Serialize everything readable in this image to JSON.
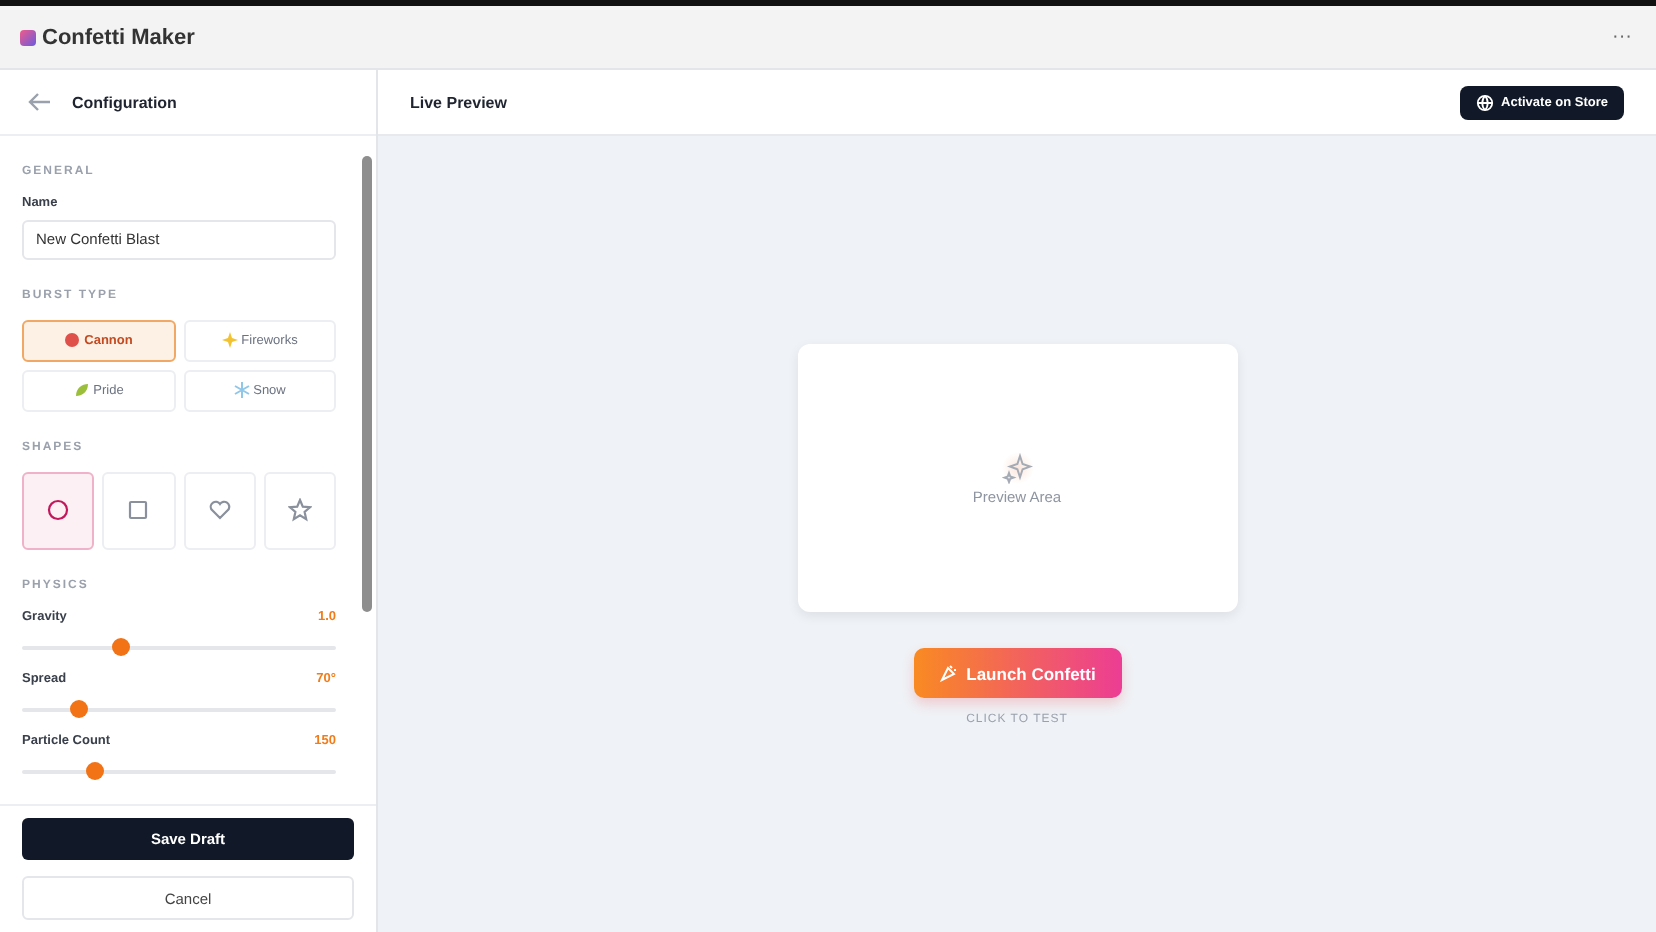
{
  "app": {
    "title": "Confetti Maker",
    "menu": "···"
  },
  "sidebar": {
    "title": "Configuration",
    "general": {
      "heading": "GENERAL",
      "name_label": "Name",
      "name_value": "New Confetti Blast"
    },
    "burst": {
      "heading": "BURST TYPE",
      "options": [
        {
          "label": "Cannon",
          "kind": "cannon",
          "selected": true
        },
        {
          "label": "Fireworks",
          "kind": "fireworks",
          "selected": false
        },
        {
          "label": "Pride",
          "kind": "pride",
          "selected": false
        },
        {
          "label": "Snow",
          "kind": "snow",
          "selected": false
        }
      ]
    },
    "shapes": {
      "heading": "SHAPES",
      "options": [
        {
          "kind": "circle",
          "selected": true
        },
        {
          "kind": "square",
          "selected": false
        },
        {
          "kind": "heart",
          "selected": false
        },
        {
          "kind": "star",
          "selected": false
        }
      ]
    },
    "physics": {
      "heading": "PHYSICS",
      "sliders": [
        {
          "label": "Gravity",
          "reading": "1.0",
          "level": 0.31
        },
        {
          "label": "Spread",
          "reading": "70°",
          "level": 0.18
        },
        {
          "label": "Particle Count",
          "reading": "150",
          "level": 0.23
        }
      ]
    },
    "buttons": {
      "save": "Save Draft",
      "cancel": "Cancel"
    }
  },
  "main": {
    "title": "Live Preview",
    "action": "Activate on Store",
    "preview_label": "Preview Area",
    "launch": "Launch Confetti",
    "hint": "CLICK TO TEST"
  }
}
